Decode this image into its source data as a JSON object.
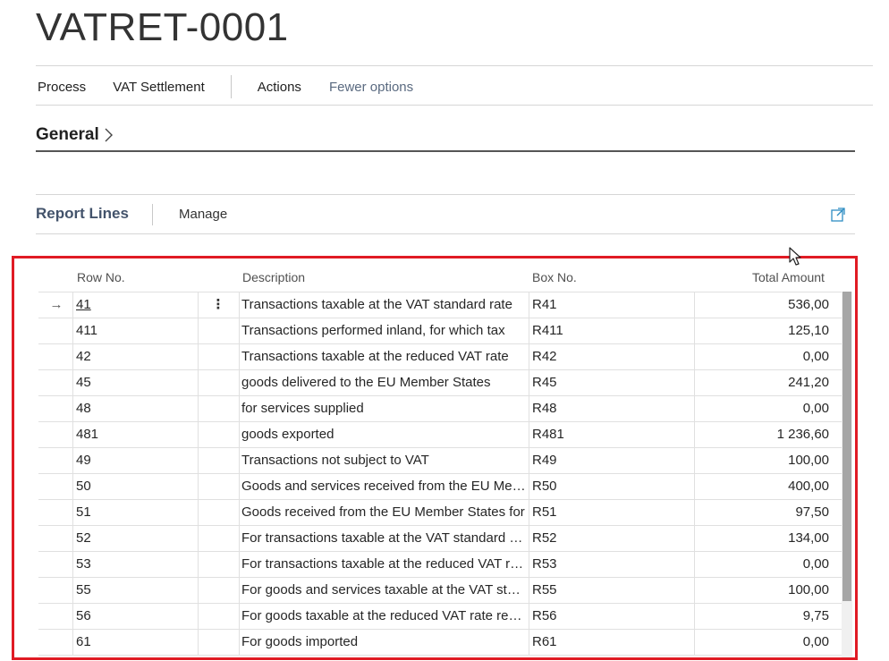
{
  "page": {
    "title": "VATRET-0001"
  },
  "actionbar": {
    "process": "Process",
    "vat_settlement": "VAT Settlement",
    "actions": "Actions",
    "fewer_options": "Fewer options"
  },
  "general": {
    "label": "General",
    "chevron": ">"
  },
  "report_lines": {
    "title": "Report Lines",
    "manage": "Manage",
    "expand_icon": "expand-icon"
  },
  "grid": {
    "columns": {
      "row_no": "Row No.",
      "description": "Description",
      "box_no": "Box No.",
      "total_amount": "Total Amount"
    },
    "current_row_marker": "→",
    "row_actions": "⋮",
    "rows": [
      {
        "row_no": "41",
        "description": "Transactions taxable at the VAT standard rate",
        "box_no": "R41",
        "total_amount": "536,00"
      },
      {
        "row_no": "411",
        "description": "Transactions performed inland, for which tax",
        "box_no": "R411",
        "total_amount": "125,10"
      },
      {
        "row_no": "42",
        "description": "Transactions taxable at the reduced VAT rate",
        "box_no": "R42",
        "total_amount": "0,00"
      },
      {
        "row_no": "45",
        "description": "goods delivered to the EU Member States",
        "box_no": "R45",
        "total_amount": "241,20"
      },
      {
        "row_no": "48",
        "description": "for services supplied",
        "box_no": "R48",
        "total_amount": "0,00"
      },
      {
        "row_no": "481",
        "description": "goods exported",
        "box_no": "R481",
        "total_amount": "1 236,60"
      },
      {
        "row_no": "49",
        "description": "Transactions not subject to VAT",
        "box_no": "R49",
        "total_amount": "100,00"
      },
      {
        "row_no": "50",
        "description": "Goods and services received from the EU Member",
        "box_no": "R50",
        "total_amount": "400,00"
      },
      {
        "row_no": "51",
        "description": "Goods received from the EU Member States for",
        "box_no": "R51",
        "total_amount": "97,50"
      },
      {
        "row_no": "52",
        "description": "For transactions taxable at the VAT standard rate",
        "box_no": "R52",
        "total_amount": "134,00"
      },
      {
        "row_no": "53",
        "description": "For transactions taxable at the reduced VAT rate",
        "box_no": "R53",
        "total_amount": "0,00"
      },
      {
        "row_no": "55",
        "description": "For goods and services taxable at the VAT standard",
        "box_no": "R55",
        "total_amount": "100,00"
      },
      {
        "row_no": "56",
        "description": "For goods taxable at the reduced VAT rate received",
        "box_no": "R56",
        "total_amount": "9,75"
      },
      {
        "row_no": "61",
        "description": "For goods imported",
        "box_no": "R61",
        "total_amount": "0,00"
      }
    ]
  },
  "colors": {
    "highlight_frame": "#e01b24",
    "section_title": "#43536b",
    "accent_icon": "#2e8dc2"
  }
}
